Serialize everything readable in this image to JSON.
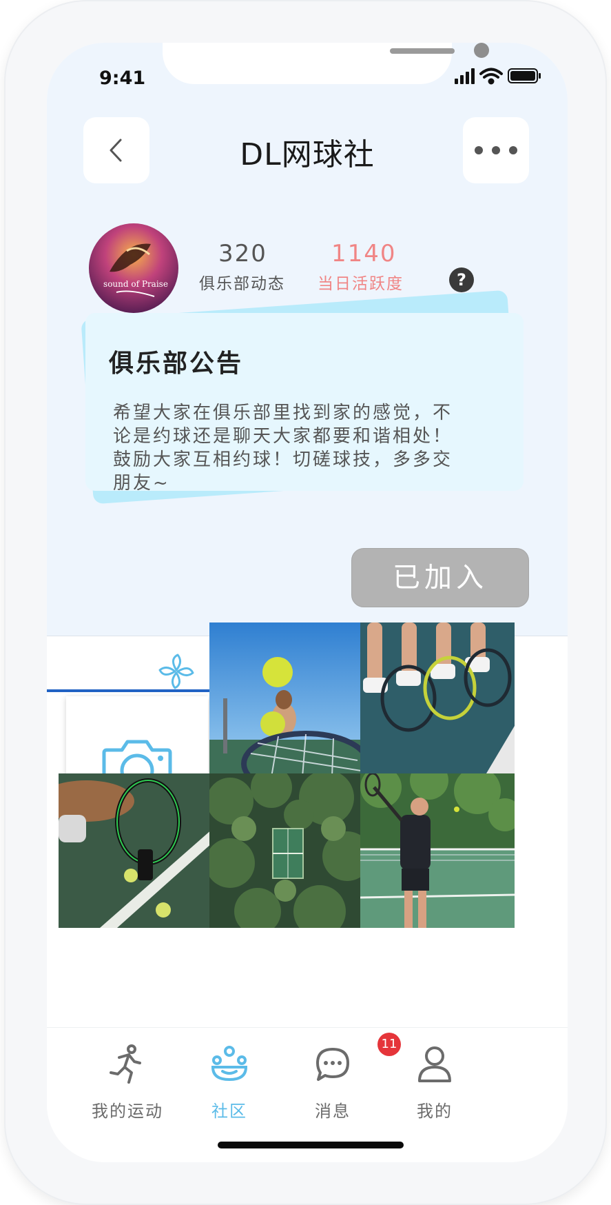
{
  "status_bar": {
    "time": "9:41"
  },
  "header": {
    "title": "DL网球社",
    "back_icon": "chevron-left-icon",
    "more_icon": "ellipsis-icon"
  },
  "club": {
    "avatar_text": "sound of Praise",
    "posts_count": "320",
    "posts_label": "俱乐部动态",
    "activity_count": "1140",
    "activity_label": "当日活跃度",
    "help_symbol": "?"
  },
  "notice": {
    "title": "俱乐部公告",
    "lines": [
      "希望大家在俱乐部里找到家的感觉，不",
      "论是约球还是聊天大家都要和谐相处！",
      "鼓励大家互相约球！切磋球技，多多交",
      "朋友~"
    ]
  },
  "join_button": {
    "label": "已加入"
  },
  "tabs": [
    {
      "icon": "pinwheel-icon",
      "active": true
    },
    {
      "icon": "members-icon",
      "active": false
    }
  ],
  "gallery": {
    "upload_icon": "camera-icon",
    "photos": [
      "player-serving-tennis-balls",
      "legs-and-rackets-on-bench",
      "racket-and-balls-on-court",
      "aerial-court-in-trees",
      "player-on-court-with-palms"
    ]
  },
  "bottom_nav": [
    {
      "label": "我的运动",
      "icon": "running-icon",
      "color": "#6b6b6b"
    },
    {
      "label": "社区",
      "icon": "community-icon",
      "color": "#5bbbe8",
      "active": true
    },
    {
      "label": "消息",
      "icon": "message-icon",
      "color": "#6b6b6b",
      "badge": "11"
    },
    {
      "label": "我的",
      "icon": "profile-icon",
      "color": "#6b6b6b"
    }
  ],
  "colors": {
    "accent_blue": "#5bbbe8",
    "activity_red": "#f08585",
    "tab_underline": "#2162c4",
    "badge_red": "#e5353a"
  }
}
